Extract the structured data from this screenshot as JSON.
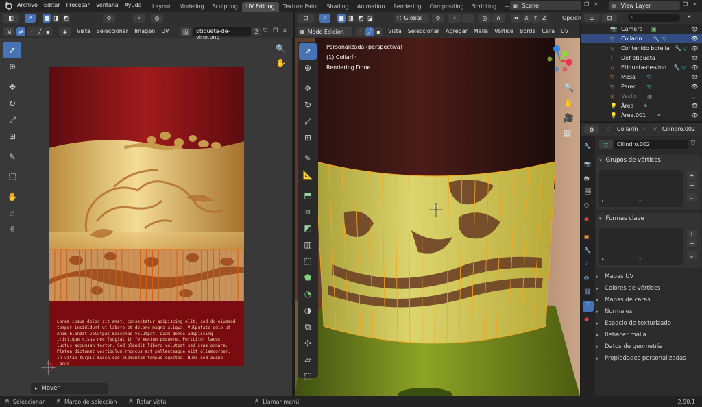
{
  "topbar": {
    "menus": [
      "Archivo",
      "Editar",
      "Procesar",
      "Ventana",
      "Ayuda"
    ],
    "workspaces": [
      "Layout",
      "Modeling",
      "Sculpting",
      "UV Editing",
      "Texture Paint",
      "Shading",
      "Animation",
      "Rendering",
      "Compositing",
      "Scripting"
    ],
    "active_workspace": "UV Editing",
    "scene": "Scene",
    "view_layer": "View Layer"
  },
  "uv_editor": {
    "menus": [
      "Vista",
      "Seleccionar",
      "Imagen",
      "UV"
    ],
    "image_name": "Etiqueta-de-vino.png",
    "user_count": "2",
    "label_text": "Lorem ipsum dolor sit amet, consectetur adipiscing elit, sed do eiusmod tempor incididunt ut labore et dolore magna aliqua. Vulputate odio ut enim blandit volutpat maecenas volutpat. Diam donec adipiscing tristique risus nec feugiat in fermentum posuere. Porttitor lacus luctus accumsan tortor. Sed blandit libero volutpat sed cras ornare. Platea dictumst vestibulum rhoncus est pellentesque elit ullamcorper. In vitae turpis massa sed elementum tempus egestas. Nunc sed augue lacus",
    "operator_panel": "Mover"
  },
  "viewport": {
    "mode": "Modo Edición",
    "menus": [
      "Vista",
      "Seleccionar",
      "Agregar",
      "Malla",
      "Vértice",
      "Borde",
      "Cara",
      "UV"
    ],
    "transform_orientation": "Global",
    "options_label": "Opcion",
    "overlay_lines": [
      "Personalizada (perspectiva)",
      "(1) Collarín",
      "Rendering Done"
    ],
    "axes": [
      "X",
      "Y",
      "Z"
    ]
  },
  "outliner": {
    "search_placeholder": "",
    "items": [
      {
        "name": "Camera"
      },
      {
        "name": "Collarín",
        "selected": true
      },
      {
        "name": "Contenido botella"
      },
      {
        "name": "Def-etiqueta"
      },
      {
        "name": "Etiqueta-de-vino"
      },
      {
        "name": "Mesa"
      },
      {
        "name": "Pared"
      },
      {
        "name": "Vacío",
        "dimmed": true
      },
      {
        "name": "Área"
      },
      {
        "name": "Área.001"
      }
    ]
  },
  "properties": {
    "object_name": "Collarín",
    "mesh_name": "Cilindro.002",
    "mesh_field": "Cilindro.002",
    "panels": {
      "vertex_groups": "Grupos de vértices",
      "shape_keys": "Formas clave"
    },
    "collapsed_panels": [
      "Mapas UV",
      "Colores de vértices",
      "Mapas de caras",
      "Normales",
      "Espacio de texturizado",
      "Rehacer malla",
      "Datos de geometría",
      "Propiedades personalizadas"
    ]
  },
  "statusbar": {
    "items": [
      "Seleccionar",
      "Marco de selección",
      "Rotar vista",
      "Llamar menú"
    ],
    "version": "2.90.1"
  },
  "colors": {
    "accent": "#4772b3",
    "header": "#303030",
    "panel": "#2b2b2b",
    "background": "#1d1d1d",
    "uv_grid": "#393939",
    "wine_red": "#7d0f14",
    "gold": "#d8b060",
    "mesh_edge": "#f5a623"
  }
}
